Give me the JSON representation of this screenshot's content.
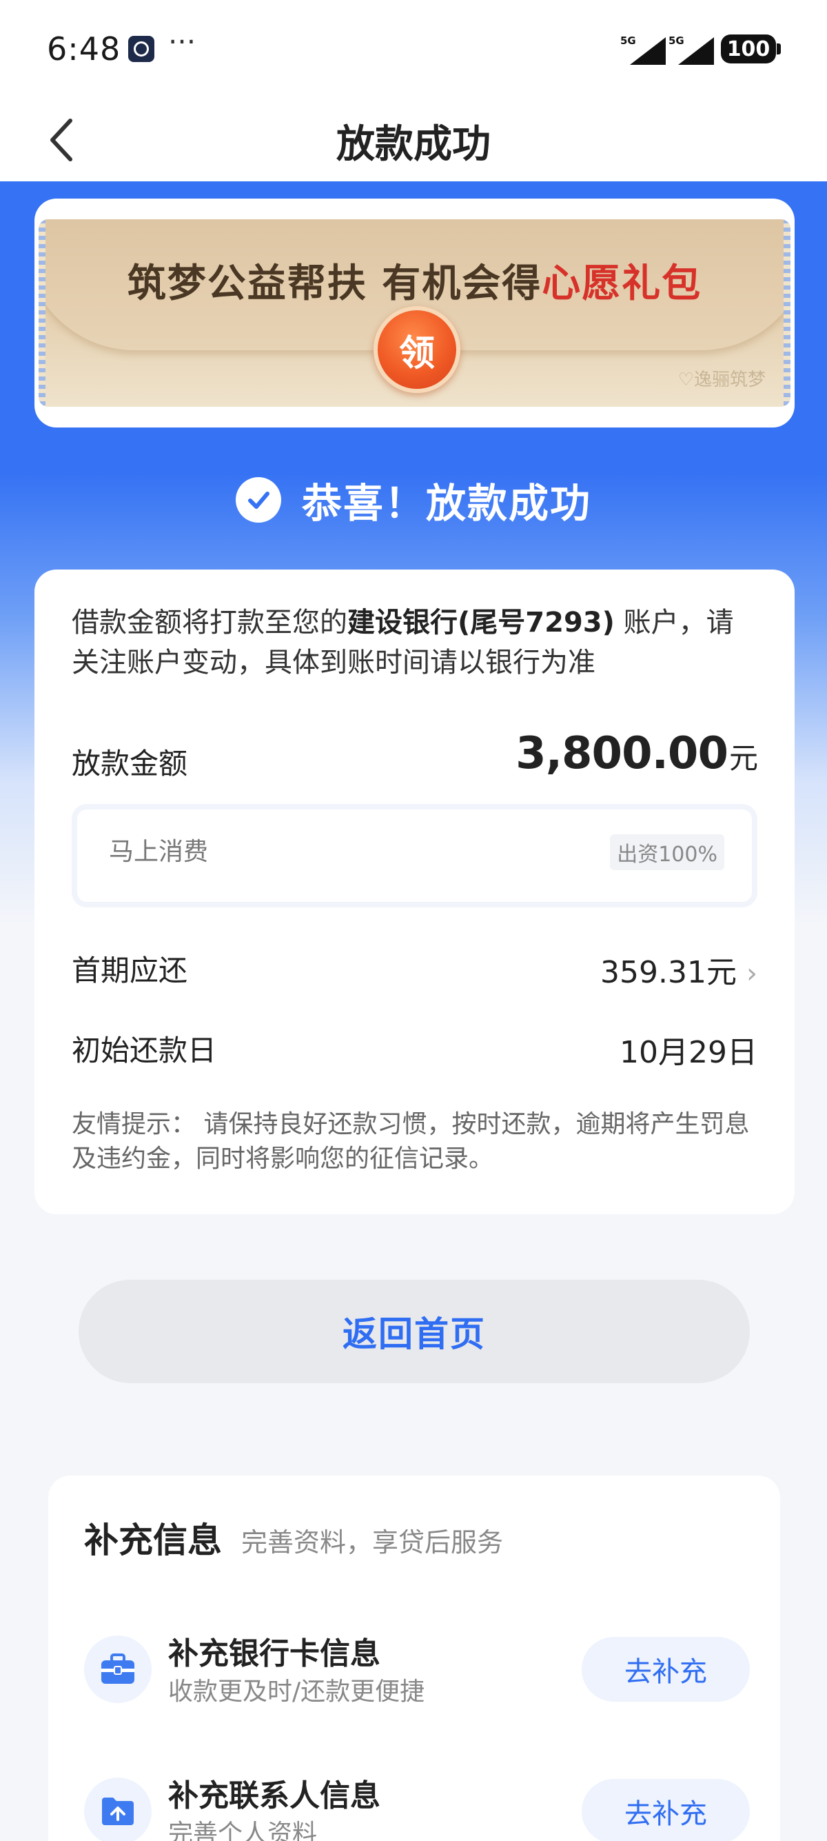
{
  "status_bar": {
    "time": "6:48",
    "dots": "···",
    "network_1": "5G",
    "network_2": "5G",
    "battery": "100"
  },
  "nav": {
    "title": "放款成功"
  },
  "banner": {
    "text_main": "筑梦公益帮扶 有机会得",
    "text_highlight": "心愿礼包",
    "claim_label": "领",
    "watermark": "♡逸骊筑梦"
  },
  "success": {
    "message": "恭喜！放款成功"
  },
  "info": {
    "desc_prefix": "借款金额将打款至您的",
    "bank": "建设银行(尾号7293)",
    "desc_suffix": " 账户，请关注账户变动，具体到账时间请以银行为准",
    "amount_label": "放款金额",
    "amount_value": "3,800.00",
    "amount_unit": "元",
    "funder_name": "马上消费",
    "funder_tag": "出资100%",
    "first_payment_label": "首期应还",
    "first_payment_value": "359.31元",
    "start_date_label": "初始还款日",
    "start_date_value": "10月29日",
    "tip": "友情提示： 请保持良好还款习惯，按时还款，逾期将产生罚息及违约金，同时将影响您的征信记录。"
  },
  "home_button": "返回首页",
  "extra": {
    "title": "补充信息",
    "subtitle": "完善资料，享贷后服务",
    "items": [
      {
        "title": "补充银行卡信息",
        "subtitle": "收款更及时/还款更便捷",
        "button": "去补充",
        "icon": "briefcase-icon"
      },
      {
        "title": "补充联系人信息",
        "subtitle": "完善个人资料",
        "button": "去补充",
        "icon": "upload-folder-icon"
      }
    ]
  },
  "colors": {
    "brand_blue": "#3572f4",
    "highlight_red": "#d7322a",
    "button_text_blue": "#2f6df2"
  }
}
